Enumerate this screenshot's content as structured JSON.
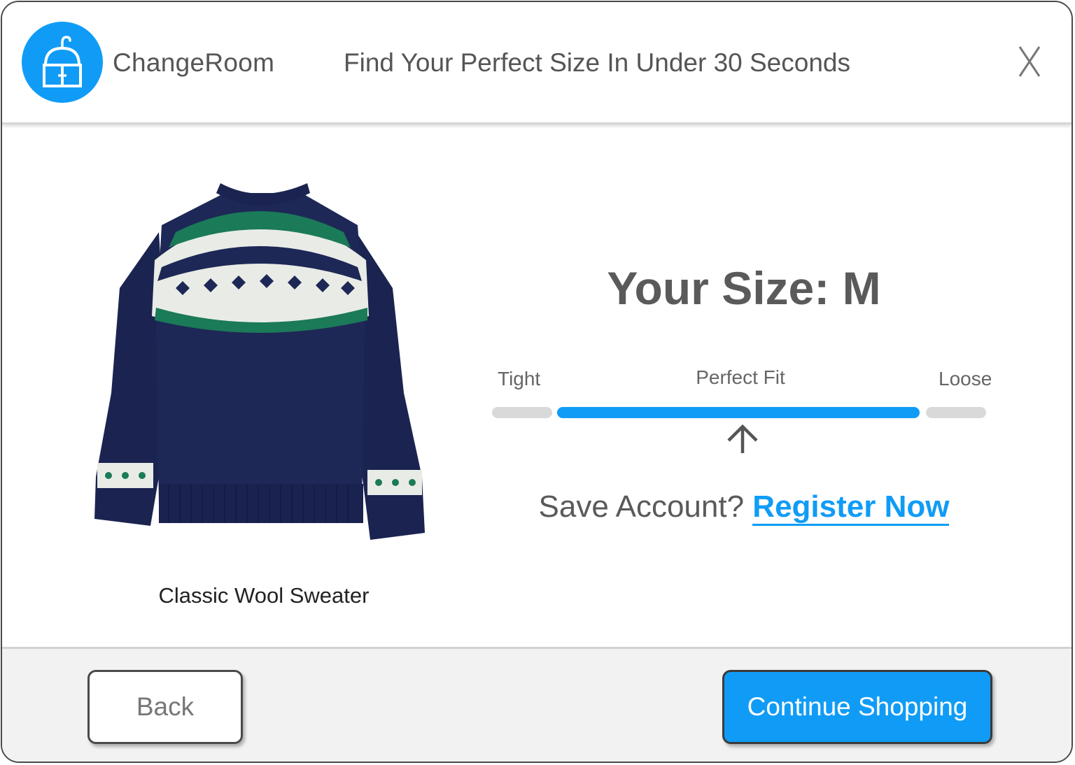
{
  "header": {
    "brand": "ChangeRoom",
    "tagline": "Find Your Perfect Size In Under 30 Seconds",
    "close_label": "X",
    "logo_icon": "changeroom-wardrobe-icon"
  },
  "product": {
    "name": "Classic Wool Sweater",
    "image_icon": "sweater-image"
  },
  "result": {
    "size_text": "Your Size: M",
    "fit_scale": {
      "tight_label": "Tight",
      "perfect_label": "Perfect Fit",
      "loose_label": "Loose",
      "selected": "Perfect Fit"
    },
    "save_prompt": "Save Account?",
    "register_label": "Register Now"
  },
  "footer": {
    "back_label": "Back",
    "continue_label": "Continue Shopping"
  },
  "colors": {
    "accent": "#109cf6",
    "text": "#5a5a5a",
    "track": "#d9d9d9"
  }
}
